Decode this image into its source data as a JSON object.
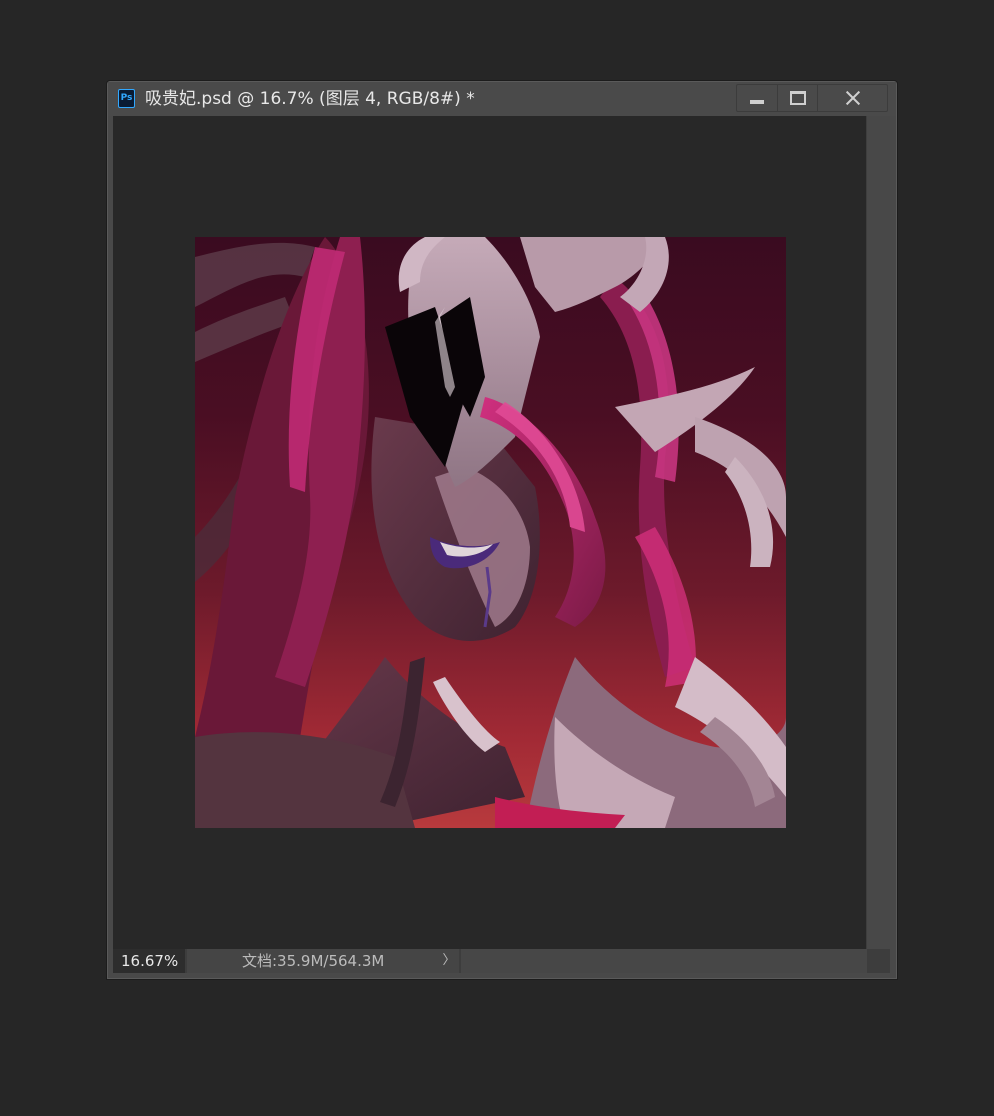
{
  "window": {
    "app_icon": "photoshop-icon",
    "app_icon_text": "Ps",
    "title": "吸贵妃.psd @ 16.7% (图层 4, RGB/8#) *",
    "buttons": [
      "minimize-icon",
      "maximize-icon",
      "close-icon"
    ]
  },
  "status": {
    "zoom": "16.67%",
    "doc_info": "文档:35.9M/564.3M",
    "arrow": "〉"
  },
  "colors": {
    "workspace_bg": "#282828",
    "window_chrome": "#4a4a4a",
    "canvas_top": "#3a0b20",
    "canvas_bottom": "#b83a3d",
    "hair_magenta": "#c02a74",
    "armor_gray": "#b49aa8",
    "skin_shadow": "#4a2a35"
  },
  "canvas": {
    "content": "digital painting of a vampire character with pink hair and white horned mask on dark crimson background"
  }
}
